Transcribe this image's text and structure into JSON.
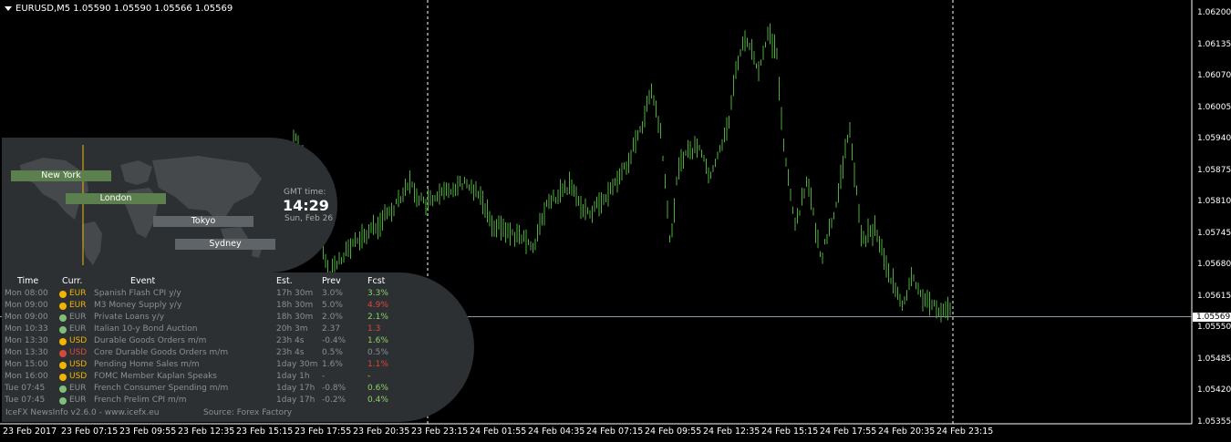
{
  "header": {
    "symbol_info": "EURUSD,M5  1.05590 1.05590 1.05566 1.05569"
  },
  "price_axis": {
    "labels": [
      "1.06200",
      "1.06135",
      "1.06070",
      "1.06005",
      "1.05940",
      "1.05875",
      "1.05810",
      "1.05745",
      "1.05680",
      "1.05615",
      "1.05550",
      "1.05485",
      "1.05420",
      "1.05355"
    ],
    "current_price": "1.05569"
  },
  "time_axis": {
    "labels": [
      "23 Feb 2017",
      "23 Feb 07:15",
      "23 Feb 09:55",
      "23 Feb 12:35",
      "23 Feb 15:15",
      "23 Feb 17:55",
      "23 Feb 20:35",
      "23 Feb 23:15",
      "24 Feb 01:55",
      "24 Feb 04:35",
      "24 Feb 07:15",
      "24 Feb 09:55",
      "24 Feb 12:35",
      "24 Feb 15:15",
      "24 Feb 17:55",
      "24 Feb 20:35",
      "24 Feb 23:15"
    ]
  },
  "colors": {
    "bars": "#4caf3a",
    "grid_dash": "#ffffff",
    "panel": "#2c3032",
    "up": "#8fd16a",
    "down": "#e0453a",
    "eur_dot": "#f1b400",
    "usd_dot": "#d44b3c",
    "low_dot": "#7fbf7a"
  },
  "sessions": {
    "new_york": "New York",
    "london": "London",
    "tokyo": "Tokyo",
    "sydney": "Sydney"
  },
  "clock": {
    "label": "GMT time:",
    "time": "14:29",
    "date": "Sun, Feb 26"
  },
  "news": {
    "headers": {
      "time": "Time",
      "curr": "Curr.",
      "event": "Event",
      "est": "Est.",
      "prev": "Prev",
      "fcst": "Fcst"
    },
    "rows": [
      {
        "time": "Mon 08:00",
        "curr": "EUR",
        "dot": "eur_dot",
        "event": "Spanish Flash CPI y/y",
        "est": "17h 30m",
        "prev": "3.0%",
        "fcst": "3.3%",
        "fcst_color": "up"
      },
      {
        "time": "Mon 09:00",
        "curr": "EUR",
        "dot": "eur_dot",
        "event": "M3 Money Supply y/y",
        "est": "18h 30m",
        "prev": "5.0%",
        "fcst": "4.9%",
        "fcst_color": "down"
      },
      {
        "time": "Mon 09:00",
        "curr": "EUR",
        "dot": "low_dot",
        "event": "Private Loans y/y",
        "est": "18h 30m",
        "prev": "2.0%",
        "fcst": "2.1%",
        "fcst_color": "up"
      },
      {
        "time": "Mon 10:33",
        "curr": "EUR",
        "dot": "low_dot",
        "event": "Italian 10-y Bond Auction",
        "est": "20h 3m",
        "prev": "2.37",
        "fcst": "1.3",
        "fcst_color": "down"
      },
      {
        "time": "Mon 13:30",
        "curr": "USD",
        "dot": "eur_dot",
        "event": "Durable Goods Orders m/m",
        "est": "23h 4s",
        "prev": "-0.4%",
        "fcst": "1.6%",
        "fcst_color": "up"
      },
      {
        "time": "Mon 13:30",
        "curr": "USD",
        "dot": "usd_dot",
        "event": "Core Durable Goods Orders m/m",
        "est": "23h 4s",
        "prev": "0.5%",
        "fcst": "0.5%",
        "fcst_color": "neutral"
      },
      {
        "time": "Mon 15:00",
        "curr": "USD",
        "dot": "eur_dot",
        "event": "Pending Home Sales m/m",
        "est": "1day 30m",
        "prev": "1.6%",
        "fcst": "1.1%",
        "fcst_color": "down"
      },
      {
        "time": "Mon 16:00",
        "curr": "USD",
        "dot": "eur_dot",
        "event": "FOMC Member Kaplan Speaks",
        "est": "1day 1h",
        "prev": "-",
        "fcst": "-",
        "fcst_color": "eur_dot"
      },
      {
        "time": "Tue 07:45",
        "curr": "EUR",
        "dot": "low_dot",
        "event": "French Consumer Spending m/m",
        "est": "1day 17h",
        "prev": "-0.8%",
        "fcst": "0.6%",
        "fcst_color": "up"
      },
      {
        "time": "Tue 07:45",
        "curr": "EUR",
        "dot": "low_dot",
        "event": "French Prelim CPI m/m",
        "est": "1day 17h",
        "prev": "-0.2%",
        "fcst": "0.4%",
        "fcst_color": "up"
      }
    ],
    "footer_left": "IceFX NewsInfo v2.6.0  -  www.icefx.eu",
    "footer_right": "Source: Forex Factory"
  }
}
